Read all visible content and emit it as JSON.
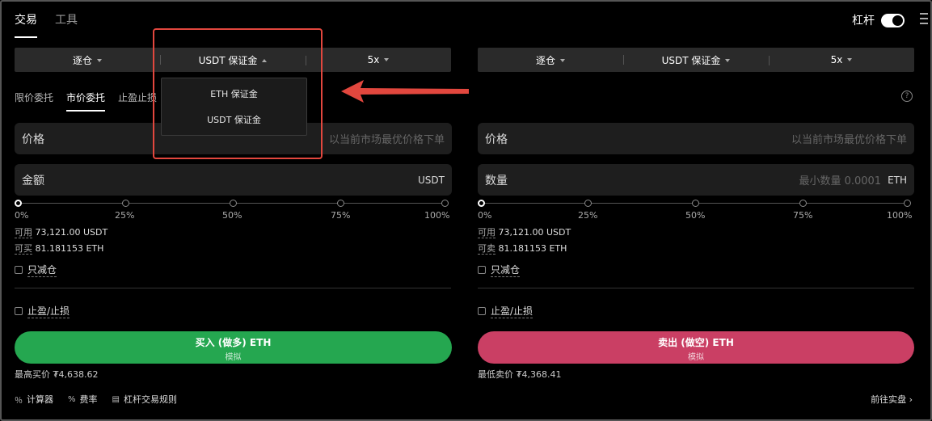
{
  "nav": {
    "tabs": [
      "交易",
      "工具"
    ],
    "lever_label": "杠杆"
  },
  "left": {
    "selector": {
      "mode": "逐仓",
      "margin": "USDT 保证金",
      "leverage": "5x"
    },
    "order_tabs": [
      "限价委托",
      "市价委托",
      "止盈止损"
    ],
    "price": {
      "label": "价格",
      "placeholder": "以当前市场最优价格下单"
    },
    "amount": {
      "label": "金额",
      "unit": "USDT"
    },
    "ticks": [
      "0%",
      "25%",
      "50%",
      "75%",
      "100%"
    ],
    "avail_k": "可用",
    "avail_v": "73,121.00 USDT",
    "buy_k": "可买",
    "buy_v": "81.181153 ETH",
    "reduce_only": "只减仓",
    "tpsl": "止盈/止损",
    "button_main": "买入 (做多) ETH",
    "button_sub": "模拟",
    "best_label": "最高买价",
    "best_value": "₮4,638.62"
  },
  "right": {
    "selector": {
      "mode": "逐仓",
      "margin": "USDT 保证金",
      "leverage": "5x"
    },
    "price": {
      "label": "价格",
      "placeholder": "以当前市场最优价格下单"
    },
    "qty": {
      "label": "数量",
      "placeholder": "最小数量 0.0001",
      "unit": "ETH"
    },
    "ticks": [
      "0%",
      "25%",
      "50%",
      "75%",
      "100%"
    ],
    "avail_k": "可用",
    "avail_v": "73,121.00 USDT",
    "sell_k": "可卖",
    "sell_v": "81.181153 ETH",
    "reduce_only": "只减仓",
    "tpsl": "止盈/止损",
    "button_main": "卖出 (做空) ETH",
    "button_sub": "模拟",
    "best_label": "最低卖价",
    "best_value": "₮4,368.41"
  },
  "dropdown": {
    "options": [
      "ETH 保证金",
      "USDT 保证金"
    ]
  },
  "footer": {
    "calc": "计算器",
    "fee": "费率",
    "rules": "杠杆交易规则",
    "real": "前往实盘"
  },
  "colors": {
    "buy": "#25a750",
    "sell": "#ca3f64",
    "highlight": "#e2473e"
  }
}
